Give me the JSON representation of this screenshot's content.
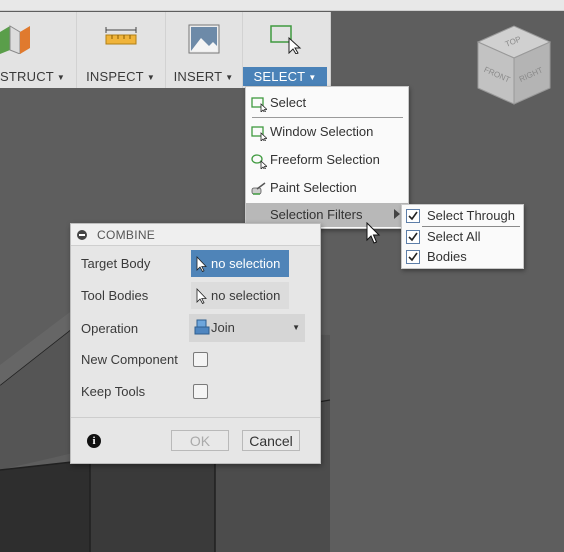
{
  "toolbar": {
    "groups": [
      {
        "label": "STRUCT",
        "icon": "construct-planes-icon"
      },
      {
        "label": "INSPECT",
        "icon": "measure-ruler-icon"
      },
      {
        "label": "INSERT",
        "icon": "insert-image-icon"
      },
      {
        "label": "SELECT",
        "icon": "select-icon",
        "active": true
      }
    ]
  },
  "viewcube": {
    "top": "TOP",
    "front": "FRONT",
    "right": "RIGHT"
  },
  "select_menu": {
    "items": [
      {
        "label": "Select",
        "icon": "select-icon"
      },
      {
        "label": "Window Selection",
        "icon": "window-selection-icon"
      },
      {
        "label": "Freeform Selection",
        "icon": "freeform-selection-icon"
      },
      {
        "label": "Paint Selection",
        "icon": "paint-selection-icon"
      },
      {
        "label": "Selection Filters",
        "has_submenu": true,
        "highlighted": true
      }
    ]
  },
  "selection_filters": {
    "items": [
      {
        "label": "Select Through",
        "checked": true
      },
      {
        "label": "Select All",
        "checked": true
      },
      {
        "label": "Bodies",
        "checked": true
      }
    ]
  },
  "combine_dialog": {
    "title": "COMBINE",
    "target_body": {
      "label": "Target Body",
      "value": "no selection"
    },
    "tool_bodies": {
      "label": "Tool Bodies",
      "value": "no selection"
    },
    "operation": {
      "label": "Operation",
      "value": "Join"
    },
    "new_component": {
      "label": "New Component",
      "checked": false
    },
    "keep_tools": {
      "label": "Keep Tools",
      "checked": false
    },
    "ok_label": "OK",
    "cancel_label": "Cancel"
  },
  "colors": {
    "accent": "#4a82b8",
    "viewport": "#5b5b5b",
    "select_icon_green": "#3f9a3f"
  }
}
